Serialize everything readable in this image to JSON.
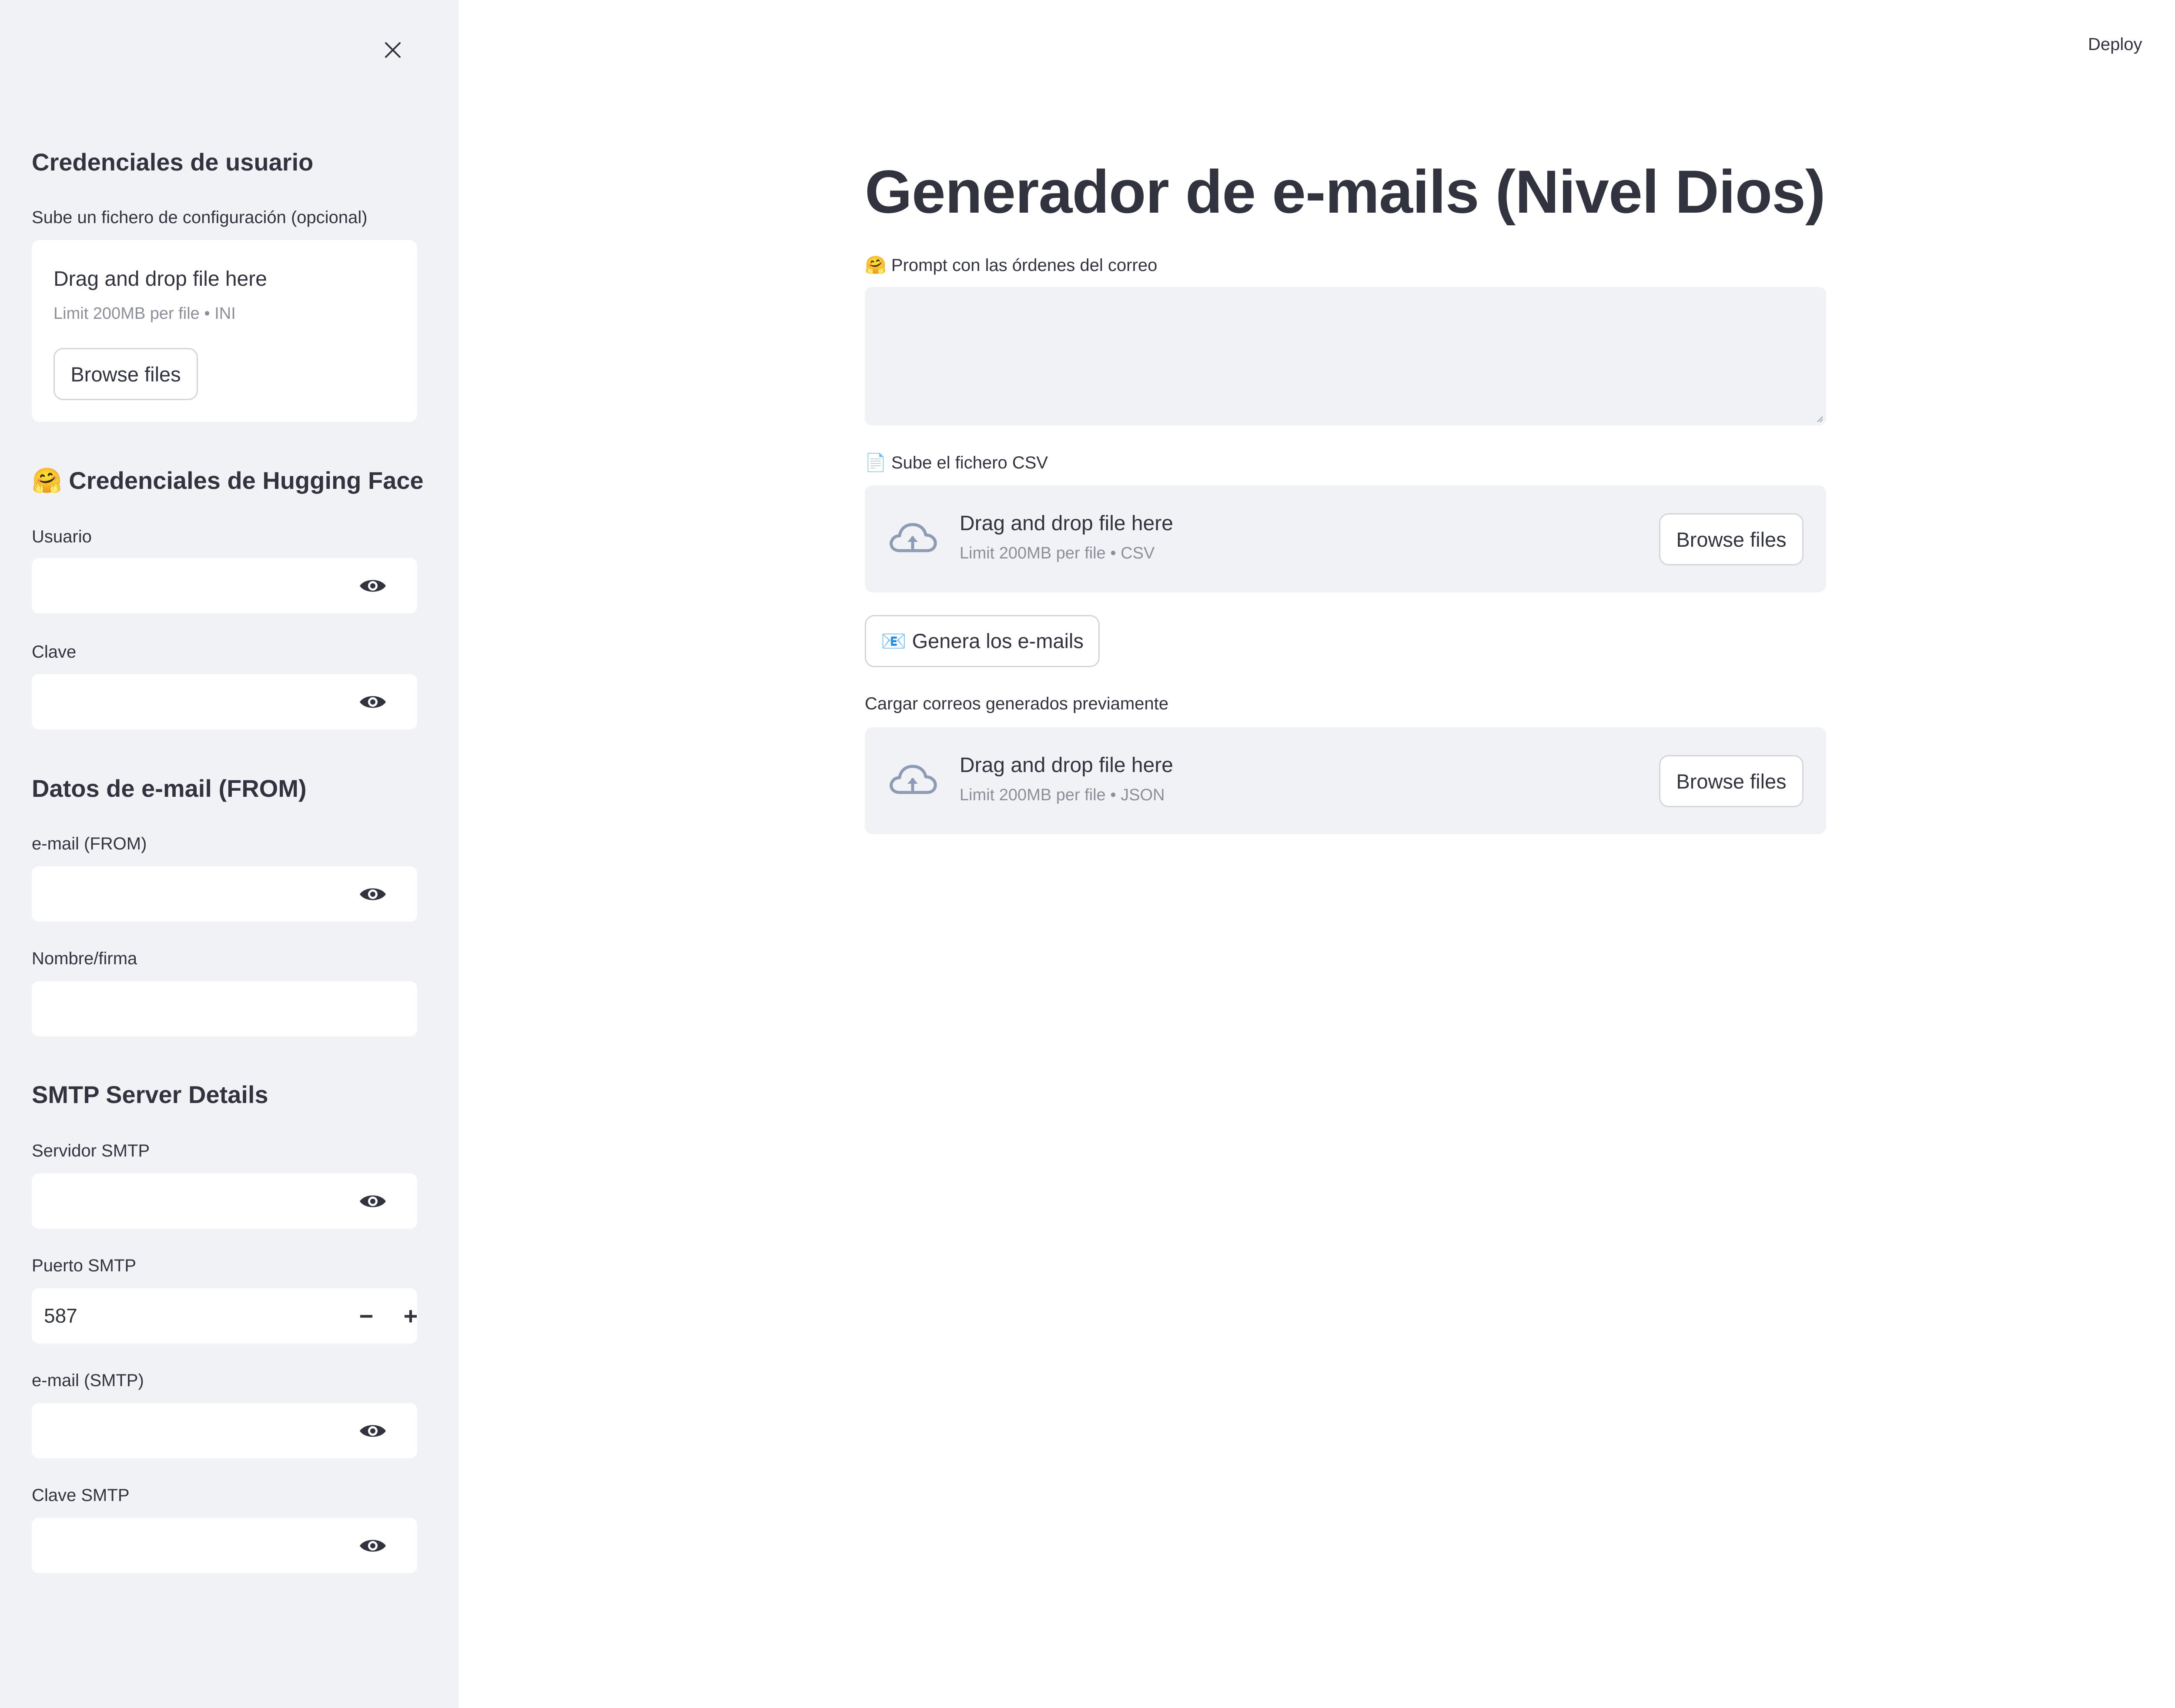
{
  "sidebar": {
    "section1_title": "Credenciales de usuario",
    "config_upload": {
      "label": "Sube un fichero de configuración (opcional)",
      "drop_text": "Drag and drop file here",
      "limit_text": "Limit 200MB per file • INI",
      "button": "Browse files"
    },
    "section2_title": "🤗 Credenciales de Hugging Face",
    "usuario_label": "Usuario",
    "clave_label": "Clave",
    "section3_title": "Datos de e-mail (FROM)",
    "email_from_label": "e-mail (FROM)",
    "nombre_label": "Nombre/firma",
    "section4_title": "SMTP Server Details",
    "servidor_label": "Servidor SMTP",
    "puerto_label": "Puerto SMTP",
    "puerto_value": "587",
    "email_smtp_label": "e-mail (SMTP)",
    "clave_smtp_label": "Clave SMTP",
    "minus": "−",
    "plus": "+"
  },
  "header": {
    "deploy": "Deploy"
  },
  "main": {
    "title": "Generador de e-mails (Nivel Dios)",
    "prompt_label": "🤗 Prompt con las órdenes del correo",
    "csv_label": "📄 Sube el fichero CSV",
    "csv_upload": {
      "drop_text": "Drag and drop file here",
      "limit_text": "Limit 200MB per file • CSV",
      "button": "Browse files"
    },
    "generate_button": "📧 Genera los e-mails",
    "load_label": "Cargar correos generados previamente",
    "json_upload": {
      "drop_text": "Drag and drop file here",
      "limit_text": "Limit 200MB per file • JSON",
      "button": "Browse files"
    }
  },
  "colors": {
    "sidebar_bg": "#f0f2f6",
    "text": "#31333f",
    "muted": "#8c8e9a",
    "cloud_icon": "#8e9bb5"
  },
  "icons": [
    "close-icon",
    "eye-icon",
    "cloud-upload-icon",
    "kebab-menu-icon"
  ]
}
